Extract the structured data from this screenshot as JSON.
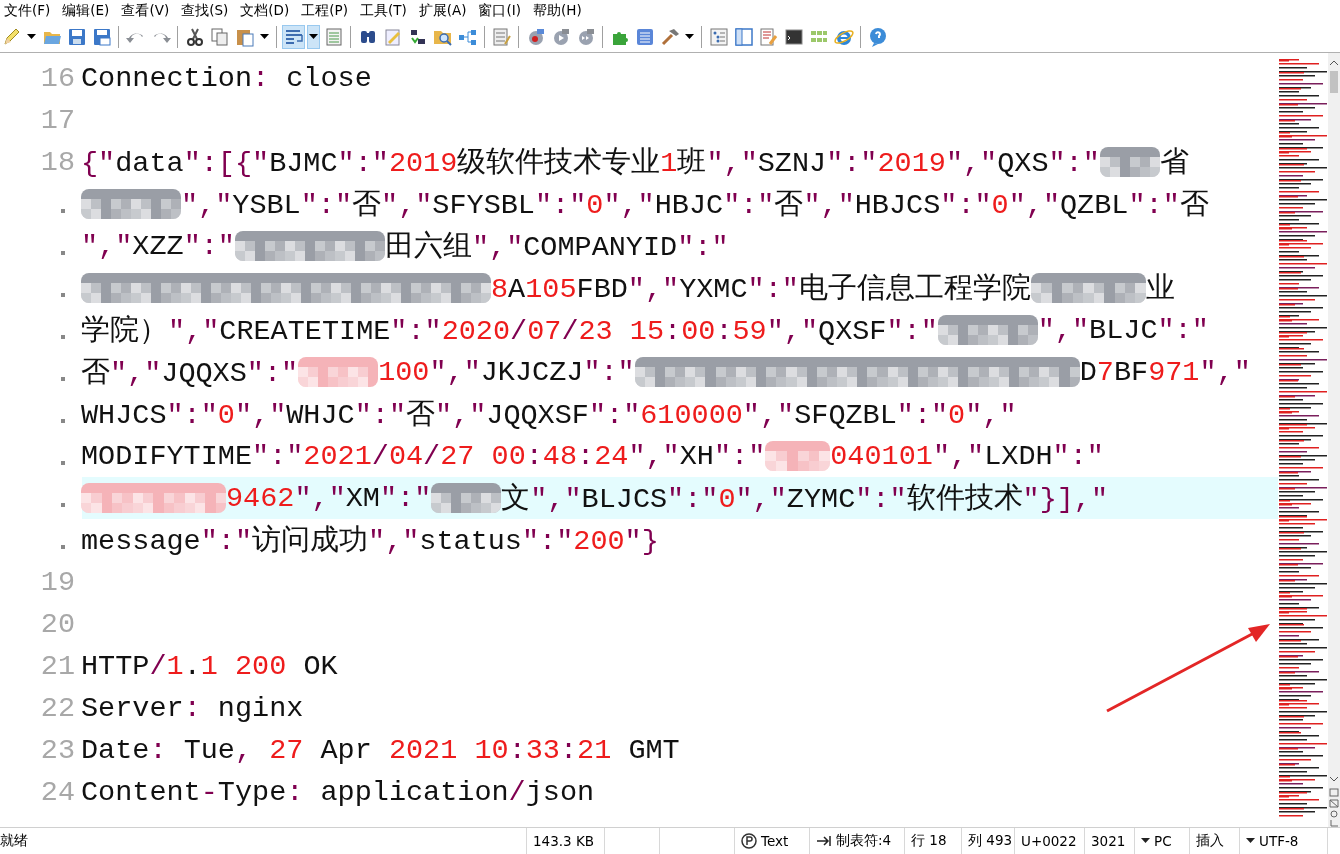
{
  "menu": [
    {
      "label": "文件(F)"
    },
    {
      "label": "编辑(E)"
    },
    {
      "label": "查看(V)"
    },
    {
      "label": "查找(S)"
    },
    {
      "label": "文档(D)"
    },
    {
      "label": "工程(P)"
    },
    {
      "label": "工具(T)"
    },
    {
      "label": "扩展(A)"
    },
    {
      "label": "窗口(I)"
    },
    {
      "label": "帮助(H)"
    }
  ],
  "toolbar": [
    {
      "kind": "new",
      "pressed": false
    },
    {
      "kind": "caret",
      "pressed": false
    },
    {
      "kind": "open",
      "pressed": false
    },
    {
      "kind": "save",
      "pressed": false
    },
    {
      "kind": "save-all",
      "pressed": false
    },
    {
      "kind": "sep"
    },
    {
      "kind": "undo",
      "pressed": false
    },
    {
      "kind": "redo",
      "pressed": false
    },
    {
      "kind": "sep"
    },
    {
      "kind": "cut",
      "pressed": false
    },
    {
      "kind": "copy",
      "pressed": false
    },
    {
      "kind": "paste",
      "pressed": false
    },
    {
      "kind": "caret",
      "pressed": false
    },
    {
      "kind": "sep"
    },
    {
      "kind": "wrap",
      "pressed": true
    },
    {
      "kind": "caret",
      "pressed": true
    },
    {
      "kind": "list",
      "pressed": false
    },
    {
      "kind": "sep"
    },
    {
      "kind": "find",
      "pressed": false
    },
    {
      "kind": "replace",
      "pressed": false
    },
    {
      "kind": "spell",
      "pressed": false
    },
    {
      "kind": "find-files",
      "pressed": false
    },
    {
      "kind": "tree",
      "pressed": false
    },
    {
      "kind": "sep"
    },
    {
      "kind": "props",
      "pressed": false
    },
    {
      "kind": "sep"
    },
    {
      "kind": "rec",
      "pressed": false
    },
    {
      "kind": "play",
      "pressed": false
    },
    {
      "kind": "run",
      "pressed": false
    },
    {
      "kind": "sep"
    },
    {
      "kind": "plugin",
      "pressed": false
    },
    {
      "kind": "window",
      "pressed": false
    },
    {
      "kind": "hammer",
      "pressed": false
    },
    {
      "kind": "caret",
      "pressed": false
    },
    {
      "kind": "sep"
    },
    {
      "kind": "outline",
      "pressed": false
    },
    {
      "kind": "sidebar",
      "pressed": false
    },
    {
      "kind": "doc",
      "pressed": false
    },
    {
      "kind": "terminal",
      "pressed": false
    },
    {
      "kind": "grid",
      "pressed": false
    },
    {
      "kind": "browser",
      "pressed": false
    },
    {
      "kind": "sep"
    },
    {
      "kind": "help",
      "pressed": false
    }
  ],
  "lines": [
    {
      "number": "16",
      "rows": [
        {
          "current": false,
          "segments": [
            {
              "kind": "code",
              "text": "Connection: close"
            }
          ]
        }
      ]
    },
    {
      "number": "17",
      "rows": [
        {
          "current": false,
          "segments": []
        }
      ]
    },
    {
      "number": "18",
      "rows": [
        {
          "current": false,
          "segments": [
            {
              "kind": "code",
              "text": "{\"data\":[{\"BJMC\":\"2019级软件技术专业1班\",\"SZNJ\":\"2019\",\"QXS\":\""
            },
            {
              "kind": "blur",
              "color": "#9a9ea6"
            },
            {
              "kind": "code",
              "text": "省"
            }
          ]
        },
        {
          "current": false,
          "segments": [
            {
              "kind": "blur",
              "color": "#9a9ea6"
            },
            {
              "kind": "code",
              "text": "\",\"YSBL\":\"否\",\"SFYSBL\":\"0\",\"HBJC\":\"否\",\"HBJCS\":\"0\",\"QZBL\":\"否"
            }
          ]
        },
        {
          "current": false,
          "segments": [
            {
              "kind": "code",
              "text": "\",\"XZZ\":\""
            },
            {
              "kind": "blur",
              "color": "#9a9ea6"
            },
            {
              "kind": "code",
              "text": "田六组\",\"COMPANYID\":\""
            }
          ]
        },
        {
          "current": false,
          "segments": [
            {
              "kind": "blur",
              "color": "#9a9ea6"
            },
            {
              "kind": "code",
              "text": "8A105FBD\",\"YXMC\":\"电子信息工程学院"
            },
            {
              "kind": "blur",
              "color": "#9a9ea6"
            },
            {
              "kind": "code",
              "text": "业"
            }
          ]
        },
        {
          "current": false,
          "segments": [
            {
              "kind": "code",
              "text": "学院）\",\"CREATETIME\":\"2020/07/23 15:00:59\",\"QXSF\":\""
            },
            {
              "kind": "blur",
              "color": "#9a9ea6"
            },
            {
              "kind": "code",
              "text": "\",\"BLJC\":\""
            }
          ]
        },
        {
          "current": false,
          "segments": [
            {
              "kind": "code",
              "text": "否\",\"JQQXS\":\""
            },
            {
              "kind": "blur",
              "color": "#f5b3b8"
            },
            {
              "kind": "code",
              "text": "100\",\"JKJCZJ\":\""
            },
            {
              "kind": "blur",
              "color": "#9a9ea6"
            },
            {
              "kind": "code",
              "text": "D7BF971\",\""
            }
          ]
        },
        {
          "current": false,
          "segments": [
            {
              "kind": "code",
              "text": "WHJCS\":\"0\",\"WHJC\":\"否\",\"JQQXSF\":\"610000\",\"SFQZBL\":\"0\",\""
            }
          ]
        },
        {
          "current": false,
          "segments": [
            {
              "kind": "code",
              "text": "MODIFYTIME\":\"2021/04/27 00:48:24\",\"XH\":\""
            },
            {
              "kind": "blur",
              "color": "#f5b3b8"
            },
            {
              "kind": "code",
              "text": "040101\",\"LXDH\":\""
            }
          ]
        },
        {
          "current": true,
          "segments": [
            {
              "kind": "blur",
              "color": "#f5b3b8"
            },
            {
              "kind": "code",
              "text": "9462\",\"XM\":\""
            },
            {
              "kind": "blur",
              "color": "#9a9ea6"
            },
            {
              "kind": "code",
              "text": "文\",\"BLJCS\":\"0\",\"ZYMC\":\"软件技术\"}],\""
            }
          ]
        },
        {
          "current": false,
          "segments": [
            {
              "kind": "code",
              "text": "message\":\"访问成功\",\"status\":\"200\"}"
            }
          ]
        }
      ]
    },
    {
      "number": "19",
      "rows": [
        {
          "current": false,
          "segments": []
        }
      ]
    },
    {
      "number": "20",
      "rows": [
        {
          "current": false,
          "segments": []
        }
      ]
    },
    {
      "number": "21",
      "rows": [
        {
          "current": false,
          "segments": [
            {
              "kind": "code",
              "text": "HTTP/1.1 200 OK"
            }
          ]
        }
      ]
    },
    {
      "number": "22",
      "rows": [
        {
          "current": false,
          "segments": [
            {
              "kind": "code",
              "text": "Server: nginx"
            }
          ]
        }
      ]
    },
    {
      "number": "23",
      "rows": [
        {
          "current": false,
          "segments": [
            {
              "kind": "code",
              "text": "Date: Tue, 27 Apr 2021 10:33:21 GMT"
            }
          ]
        }
      ]
    },
    {
      "number": "24",
      "rows": [
        {
          "current": false,
          "segments": [
            {
              "kind": "code",
              "text": "Content-Type: application/json"
            }
          ]
        }
      ]
    }
  ],
  "status_bar": [
    {
      "kind": "plain",
      "text": "就绪"
    },
    {
      "kind": "plain",
      "text": "143.3 KB"
    },
    {
      "kind": "empty"
    },
    {
      "kind": "empty"
    },
    {
      "kind": "mode",
      "text": "Text"
    },
    {
      "kind": "tab",
      "text": "制表符:4"
    },
    {
      "kind": "plain",
      "text": "行 18"
    },
    {
      "kind": "plain",
      "text": "列 493"
    },
    {
      "kind": "plain",
      "text": "U+0022"
    },
    {
      "kind": "plain",
      "text": "3021"
    },
    {
      "kind": "dropdown",
      "text": "PC"
    },
    {
      "kind": "plain",
      "text": "插入"
    },
    {
      "kind": "dropdown",
      "text": "UTF-8"
    }
  ]
}
